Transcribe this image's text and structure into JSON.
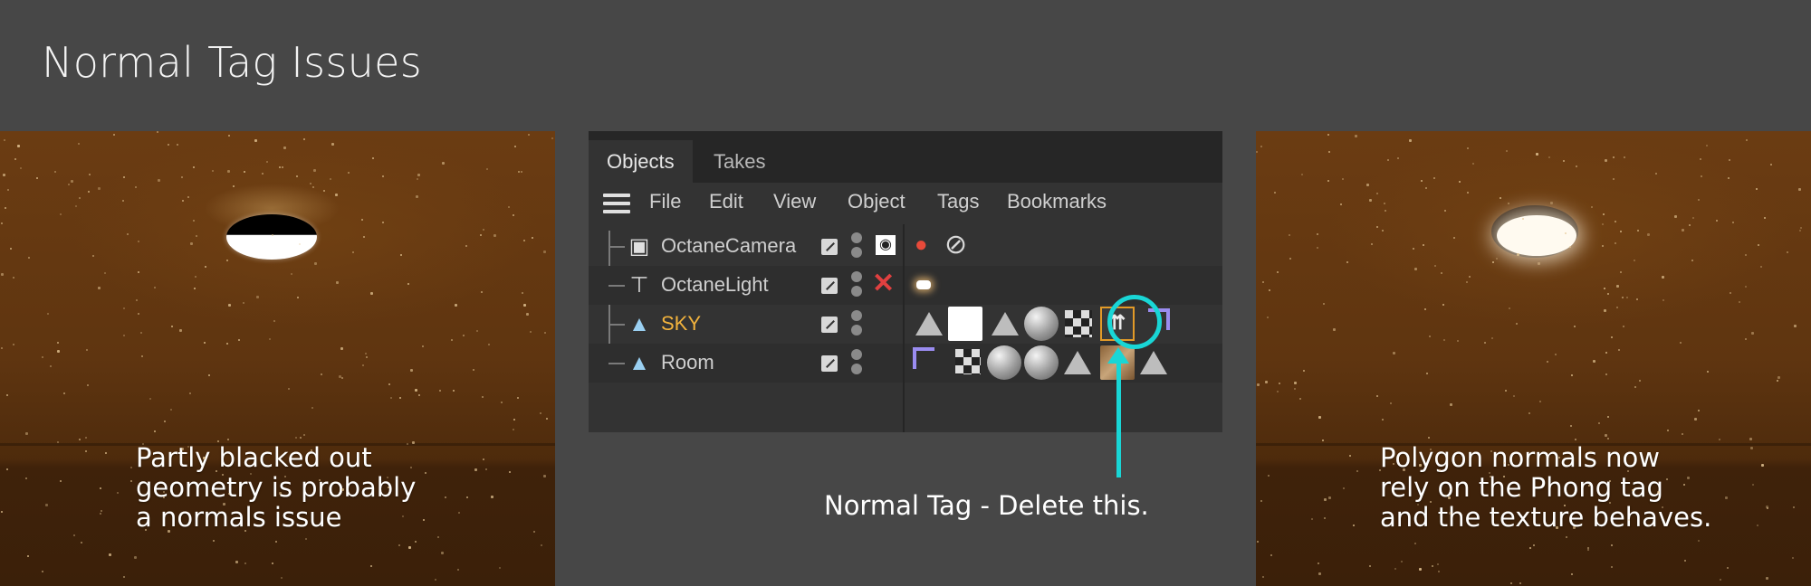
{
  "page_title": "Normal Tag Issues",
  "left_panel": {
    "caption_lines": [
      "Partly blacked out",
      "geometry is probably",
      "a normals issue"
    ]
  },
  "right_panel": {
    "caption_lines": [
      "Polygon normals now",
      "rely on the Phong tag",
      "and the texture behaves."
    ]
  },
  "object_manager": {
    "tabs": [
      {
        "label": "Objects",
        "active": true
      },
      {
        "label": "Takes",
        "active": false
      }
    ],
    "menu": [
      "File",
      "Edit",
      "View",
      "Object",
      "Tags",
      "Bookmarks"
    ],
    "rows": [
      {
        "name": "OctaneCamera",
        "icon": "camera-icon",
        "selected": false
      },
      {
        "name": "OctaneLight",
        "icon": "light-icon",
        "selected": false
      },
      {
        "name": "SKY",
        "icon": "polygon-object-icon",
        "selected": true
      },
      {
        "name": "Room",
        "icon": "polygon-object-icon",
        "selected": false
      }
    ]
  },
  "annotation": {
    "text": "Normal Tag - Delete this.",
    "color": "#19d6d6"
  },
  "colors": {
    "selected_object": "#f2b33d",
    "normal_tag_border": "#e29a28",
    "disabled_x": "#e04040"
  }
}
